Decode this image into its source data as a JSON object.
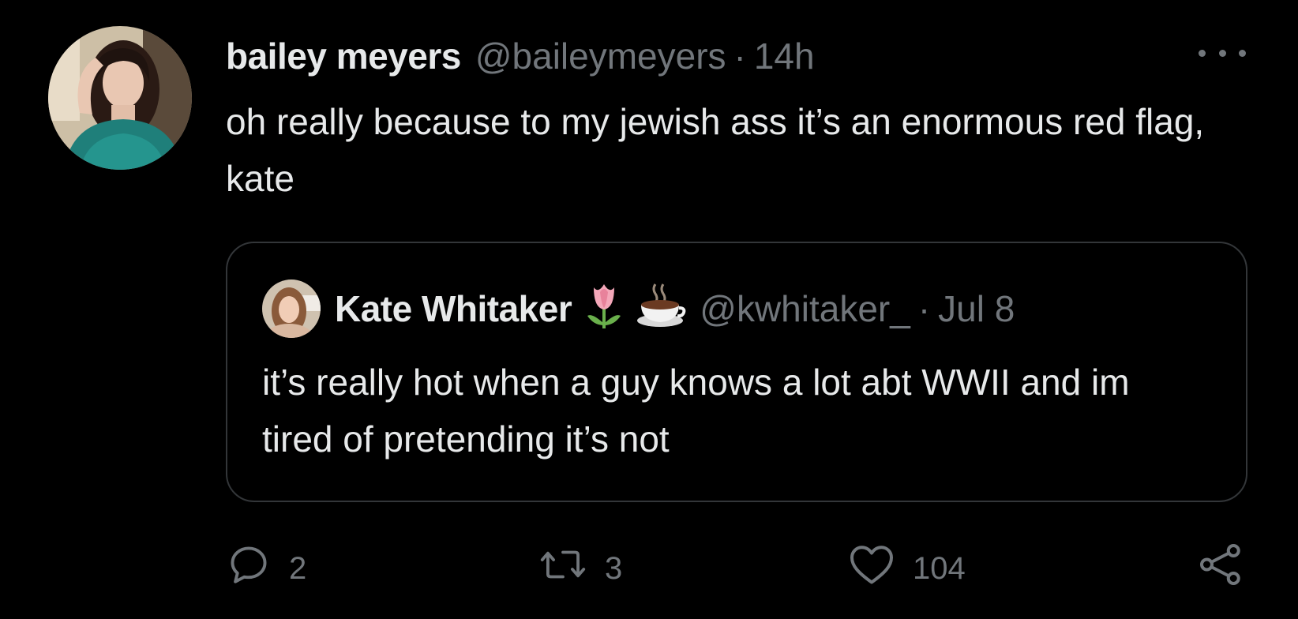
{
  "tweet": {
    "display_name": "bailey meyers",
    "handle": "@baileymeyers",
    "separator": "·",
    "time": "14h",
    "text": "oh really because to my jewish ass it’s an enormous red flag, kate",
    "more_icon": "more-horizontal-icon"
  },
  "quoted_tweet": {
    "display_name": "Kate Whitaker",
    "emoji": [
      "tulip",
      "hot-beverage"
    ],
    "handle": "@kwhitaker_",
    "separator": "·",
    "time": "Jul 8",
    "text": "it’s really hot when a guy knows a lot abt WWII and im tired of pretending it’s not"
  },
  "actions": {
    "reply": {
      "icon": "reply-icon",
      "count": "2"
    },
    "retweet": {
      "icon": "retweet-icon",
      "count": "3"
    },
    "like": {
      "icon": "heart-icon",
      "count": "104"
    },
    "share": {
      "icon": "share-icon"
    }
  },
  "colors": {
    "background": "#000000",
    "primary_text": "#e7e9ea",
    "secondary_text": "#71767b",
    "border": "#333639"
  }
}
